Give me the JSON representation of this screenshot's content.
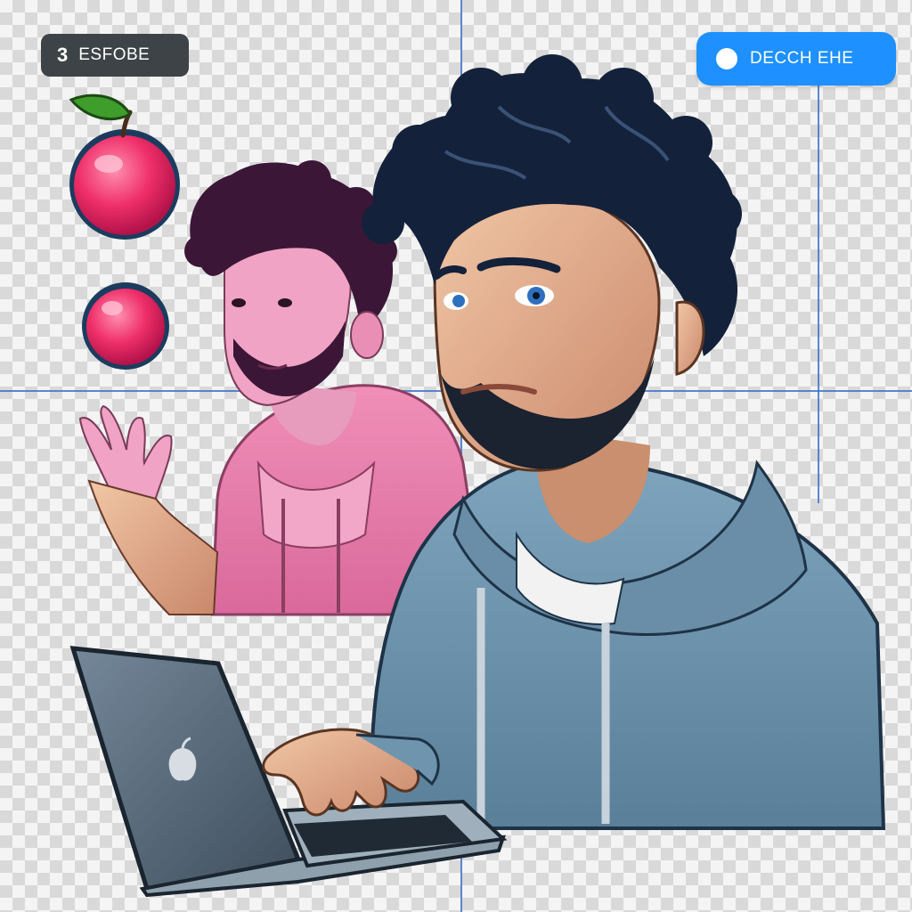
{
  "canvas": {
    "background": "transparency-checkerboard",
    "guide_color": "#3f74c9"
  },
  "badges": {
    "left": {
      "number": "3",
      "label": "ESFOBE",
      "color": "#3d4347"
    },
    "right": {
      "label": "DECCH EHE",
      "icon": "blob-icon",
      "color": "#1e90ff"
    }
  },
  "objects": {
    "apple_large": {
      "icon": "apple-icon",
      "color": "#ef2f69"
    },
    "apple_small": {
      "icon": "apple-icon",
      "color": "#ef2f69"
    },
    "person_pink": {
      "hoodie_color": "#e77eaa",
      "hair_color": "#3b1637"
    },
    "person_blue": {
      "hoodie_color": "#6f94ae",
      "hair_color": "#14213a"
    },
    "laptop": {
      "icon": "apple-logo-icon",
      "color": "#5d6d7b"
    }
  }
}
